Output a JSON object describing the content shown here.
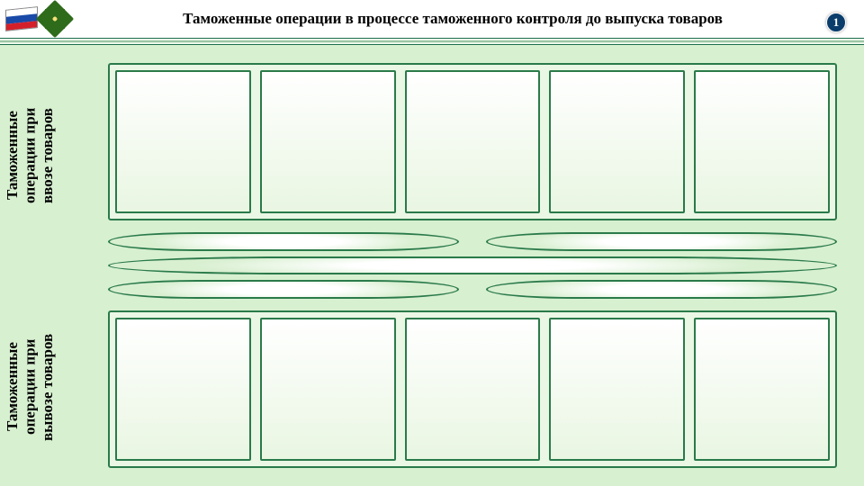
{
  "header": {
    "title": "Таможенные операции в процессе таможенного контроля до выпуска товаров",
    "page_number": "1"
  },
  "labels": {
    "import": "Таможенные операции при ввозе товаров",
    "export": "Таможенные операции при вывозе товаров"
  },
  "rows": {
    "top_cells": 5,
    "bottom_cells": 5
  }
}
